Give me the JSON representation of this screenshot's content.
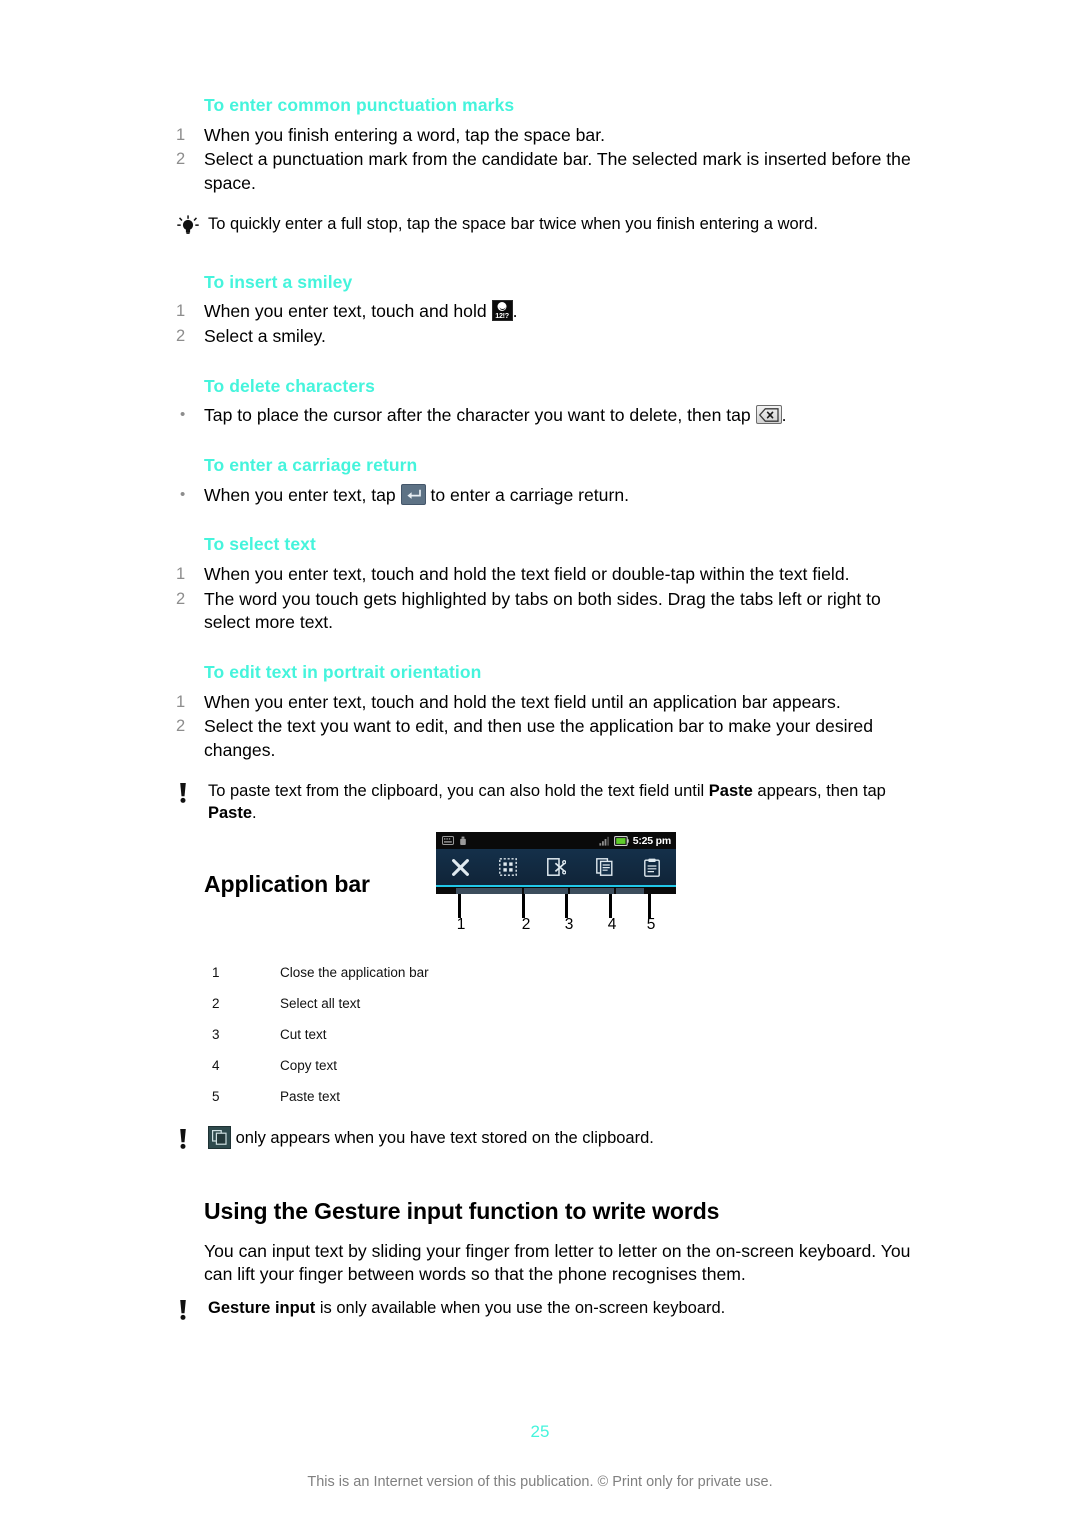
{
  "page": {
    "number": "25",
    "footer": "This is an Internet version of this publication. © Print only for private use."
  },
  "colors": {
    "heading_accent": "#45f4dc",
    "step_number": "#8d8d8d",
    "appbar_underline": "#21c8e8",
    "footer_text": "#808080"
  },
  "sections": {
    "punctuation": {
      "heading": "To enter common punctuation marks",
      "steps": [
        {
          "num": "1",
          "text": "When you finish entering a word, tap the space bar."
        },
        {
          "num": "2",
          "text": "Select a punctuation mark from the candidate bar. The selected mark is inserted before the space."
        }
      ],
      "tip": {
        "icon": "lightbulb-icon",
        "text": "To quickly enter a full stop, tap the space bar twice when you finish entering a word."
      }
    },
    "smiley": {
      "heading": "To insert a smiley",
      "steps": [
        {
          "num": "1",
          "text_before": "When you enter text, touch and hold ",
          "icon": "smiley-key-icon",
          "icon_label": "12!?",
          "text_after": "."
        },
        {
          "num": "2",
          "text": "Select a smiley."
        }
      ]
    },
    "delete": {
      "heading": "To delete characters",
      "steps": [
        {
          "bullet": "•",
          "text_before": "Tap to place the cursor after the character you want to delete, then tap ",
          "icon": "backspace-key-icon",
          "text_after": "."
        }
      ]
    },
    "carriage_return": {
      "heading": "To enter a carriage return",
      "steps": [
        {
          "bullet": "•",
          "text_before": "When you enter text, tap ",
          "icon": "enter-key-icon",
          "text_after": " to enter a carriage return."
        }
      ]
    },
    "select_text": {
      "heading": "To select text",
      "steps": [
        {
          "num": "1",
          "text": "When you enter text, touch and hold the text field or double-tap within the text field."
        },
        {
          "num": "2",
          "text": "The word you touch gets highlighted by tabs on both sides. Drag the tabs left or right to select more text."
        }
      ]
    },
    "edit_portrait": {
      "heading": "To edit text in portrait orientation",
      "steps": [
        {
          "num": "1",
          "text": "When you enter text, touch and hold the text field until an application bar appears."
        },
        {
          "num": "2",
          "text": "Select the text you want to edit, and then use the application bar to make your desired changes."
        }
      ],
      "note": {
        "icon": "exclamation-icon",
        "part1": "To paste text from the clipboard, you can also hold the text field until ",
        "bold1": "Paste",
        "part2": " appears, then tap ",
        "bold2": "Paste",
        "part3": "."
      }
    },
    "application_bar": {
      "heading": "Application bar",
      "screenshot": {
        "status_bar": {
          "time": "5:25 pm",
          "left_icons": [
            "keyboard-icon",
            "usb-icon"
          ],
          "right_icons": [
            "signal-icon",
            "battery-icon"
          ]
        },
        "buttons": [
          {
            "callout": "1",
            "icon": "close-x-icon"
          },
          {
            "callout": "2",
            "icon": "select-all-icon"
          },
          {
            "callout": "3",
            "icon": "cut-icon"
          },
          {
            "callout": "4",
            "icon": "copy-icon"
          },
          {
            "callout": "5",
            "icon": "paste-icon"
          }
        ]
      },
      "legend_rows": [
        {
          "num": "1",
          "label": "Close the application bar"
        },
        {
          "num": "2",
          "label": "Select all text"
        },
        {
          "num": "3",
          "label": "Cut text"
        },
        {
          "num": "4",
          "label": "Copy text"
        },
        {
          "num": "5",
          "label": "Paste text"
        }
      ],
      "note": {
        "icon": "exclamation-icon",
        "chip_icon": "paste-icon",
        "text": " only appears when you have text stored on the clipboard."
      }
    },
    "gesture_input": {
      "heading": "Using the Gesture input function to write words",
      "body": "You can input text by sliding your finger from letter to letter on the on-screen keyboard. You can lift your finger between words so that the phone recognises them.",
      "note": {
        "icon": "exclamation-icon",
        "bold": "Gesture input",
        "text": " is only available when you use the on-screen keyboard."
      }
    }
  }
}
